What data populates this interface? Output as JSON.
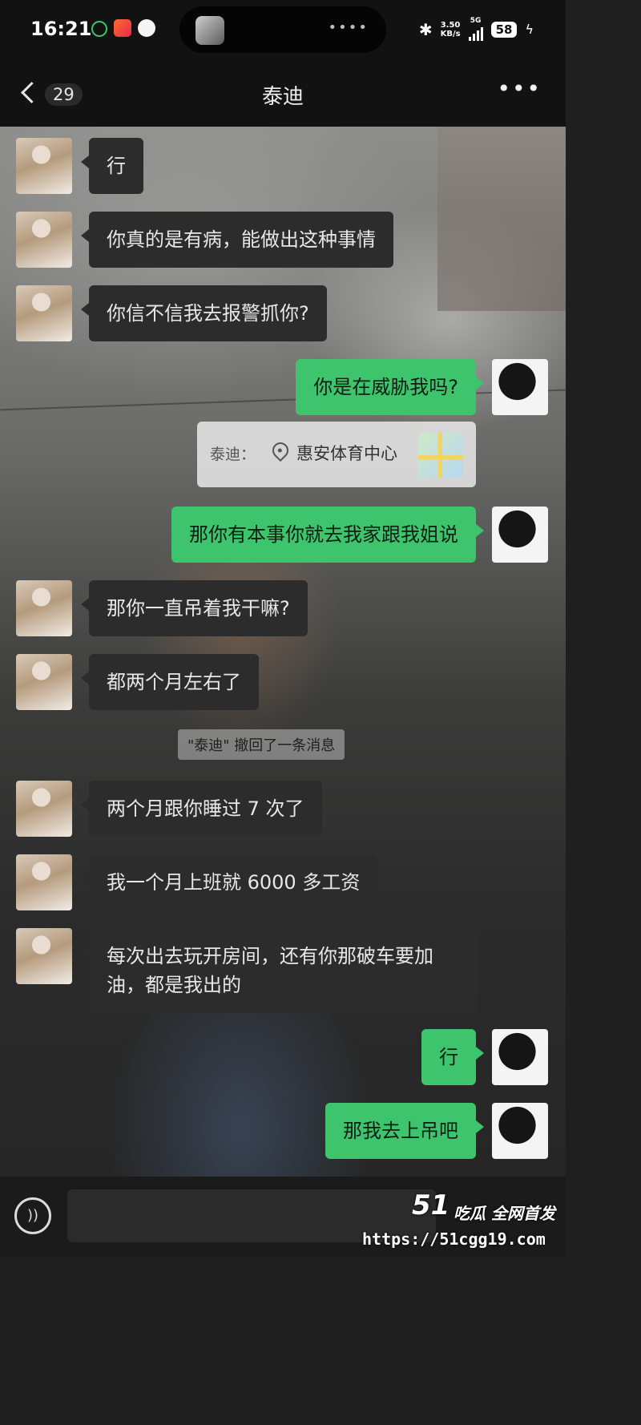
{
  "status_bar": {
    "time": "16:21",
    "network_speed": "3.50\nKB/s",
    "network_type": "5G",
    "battery": "58"
  },
  "nav": {
    "back_count": "29",
    "title": "泰迪"
  },
  "messages": [
    {
      "from": "them",
      "text": "行"
    },
    {
      "from": "them",
      "text": "你真的是有病，能做出这种事情"
    },
    {
      "from": "them",
      "text": "你信不信我去报警抓你?"
    },
    {
      "from": "me",
      "text": "你是在威胁我吗?"
    },
    {
      "from": "me",
      "text": "那你有本事你就去我家跟我姐说"
    },
    {
      "from": "them",
      "text": "那你一直吊着我干嘛?"
    },
    {
      "from": "them",
      "text": "都两个月左右了"
    },
    {
      "from": "them",
      "text": "两个月跟你睡过 7 次了"
    },
    {
      "from": "them",
      "text": "我一个月上班就 6000 多工资"
    },
    {
      "from": "them",
      "text": "每次出去玩开房间，还有你那破车要加油，都是我出的"
    },
    {
      "from": "me",
      "text": "行"
    },
    {
      "from": "me",
      "text": "那我去上吊吧"
    }
  ],
  "location_share": {
    "sender": "泰迪：",
    "place": "惠安体育中心"
  },
  "system_message": "\"泰迪\" 撤回了一条消息",
  "input": {
    "placeholder": ""
  },
  "watermark": {
    "logo": "51",
    "tagline": "吃瓜 全网首发",
    "url": "https://51cgg19.com"
  },
  "colors": {
    "my_bubble": "#3ec46d",
    "their_bubble": "#2c2c2c"
  }
}
